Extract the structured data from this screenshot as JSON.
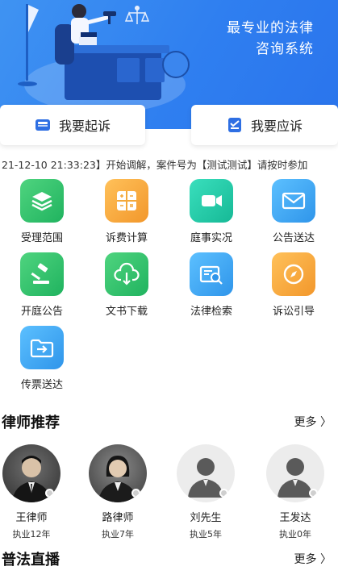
{
  "banner": {
    "line1": "最专业的法律",
    "line2": "咨询系统"
  },
  "actions": {
    "sue_label": "我要起诉",
    "respond_label": "我要应诉"
  },
  "ticker": {
    "text": "21-12-10 21:33:23】开始调解，案件号为【测试测试】请按时参加"
  },
  "services": [
    {
      "label": "受理范围",
      "icon": "layers-icon",
      "color": "#2fbf71"
    },
    {
      "label": "诉费计算",
      "icon": "calculator-icon",
      "color": "#f4a93b"
    },
    {
      "label": "庭事实况",
      "icon": "video-camera-icon",
      "color": "#20c3a1"
    },
    {
      "label": "公告送达",
      "icon": "envelope-icon",
      "color": "#3aa8f0"
    },
    {
      "label": "开庭公告",
      "icon": "gavel-icon",
      "color": "#2fbf71"
    },
    {
      "label": "文书下载",
      "icon": "cloud-download-icon",
      "color": "#2fbf71"
    },
    {
      "label": "法律检索",
      "icon": "search-card-icon",
      "color": "#3aa8f0"
    },
    {
      "label": "诉讼引导",
      "icon": "compass-icon",
      "color": "#f4a93b"
    },
    {
      "label": "传票送达",
      "icon": "folder-arrow-icon",
      "color": "#3aa8f0"
    }
  ],
  "lawyers_section": {
    "title": "律师推荐",
    "more": "更多 〉"
  },
  "lawyers": [
    {
      "name": "王律师",
      "years": "执业12年",
      "avatar": "photo-male"
    },
    {
      "name": "路律师",
      "years": "执业7年",
      "avatar": "photo-female"
    },
    {
      "name": "刘先生",
      "years": "执业5年",
      "avatar": "placeholder"
    },
    {
      "name": "王发达",
      "years": "执业0年",
      "avatar": "placeholder"
    }
  ],
  "live_section": {
    "title": "普法直播",
    "more": "更多 〉"
  }
}
